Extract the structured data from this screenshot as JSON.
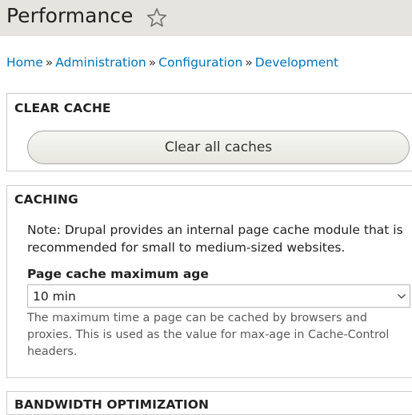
{
  "header": {
    "title": "Performance",
    "shortcut_icon": "star-outline-icon"
  },
  "breadcrumb": {
    "items": [
      "Home",
      "Administration",
      "Configuration",
      "Development"
    ],
    "separator": "»"
  },
  "clear_cache": {
    "legend": "CLEAR CACHE",
    "button_label": "Clear all caches"
  },
  "caching": {
    "legend": "CACHING",
    "note": "Note: Drupal provides an internal page cache module that is recommended for small to medium-sized websites.",
    "field_label": "Page cache maximum age",
    "selected_value": "10 min",
    "description": "The maximum time a page can be cached by browsers and proxies. This is used as the value for max-age in Cache-Control headers."
  },
  "bandwidth": {
    "legend": "BANDWIDTH OPTIMIZATION"
  },
  "colors": {
    "header_bg": "#e6e4df",
    "link": "#0074bd",
    "border": "#cccccc"
  }
}
